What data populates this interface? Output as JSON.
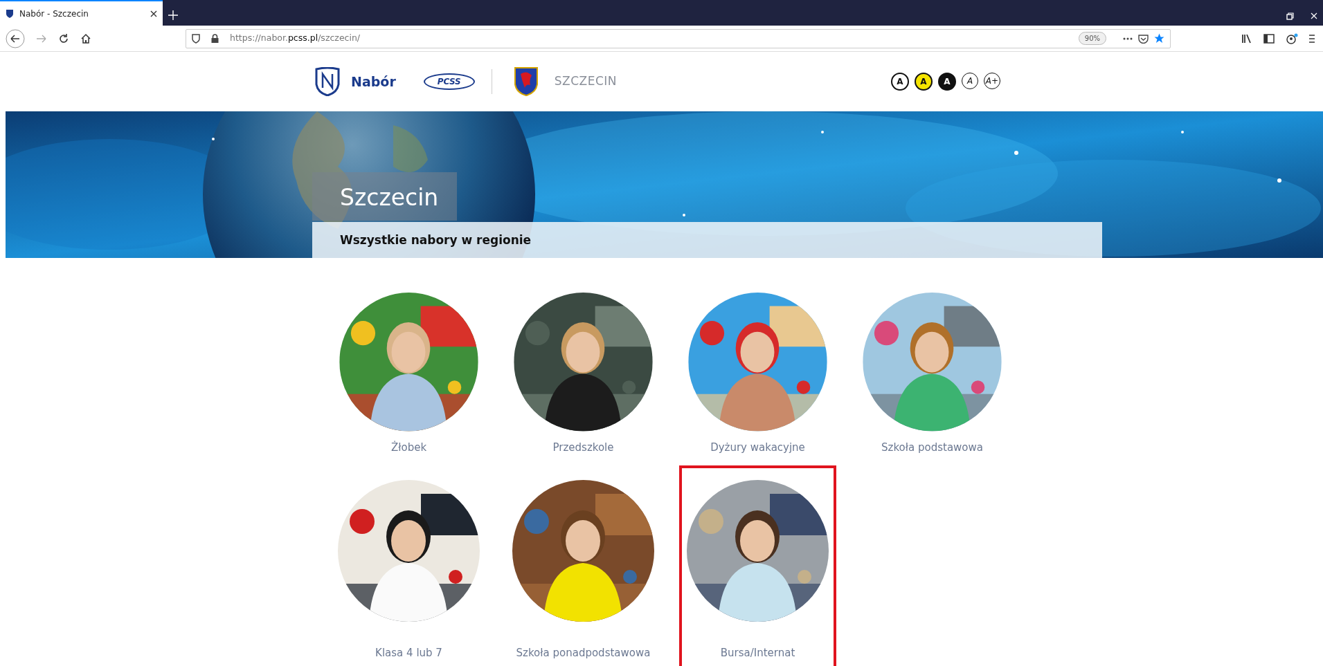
{
  "browser": {
    "tab_title": "Nabór - Szczecin",
    "url_prefix": "https://nabor.",
    "url_domain": "pcss.pl",
    "url_path": "/szczecin/",
    "zoom": "90%"
  },
  "header": {
    "brand": "Nabór",
    "partner": "PCSS",
    "city": "SZCZECIN",
    "contrast_buttons": [
      {
        "label": "A",
        "kind": "outline"
      },
      {
        "label": "A",
        "kind": "yellow"
      },
      {
        "label": "A",
        "kind": "dark"
      },
      {
        "label": "A",
        "kind": "thin"
      },
      {
        "label": "A+",
        "kind": "thin"
      }
    ]
  },
  "banner": {
    "title": "Szczecin",
    "subtitle": "Wszystkie nabory w regionie"
  },
  "categories": [
    {
      "label": "Żłobek",
      "highlighted": false
    },
    {
      "label": "Przedszkole",
      "highlighted": false
    },
    {
      "label": "Dyżury wakacyjne",
      "highlighted": false
    },
    {
      "label": "Szkoła podstawowa",
      "highlighted": false
    },
    {
      "label": "Klasa 4 lub 7",
      "highlighted": false
    },
    {
      "label": "Szkoła ponadpodstawowa",
      "highlighted": false
    },
    {
      "label": "Bursa/Internat",
      "highlighted": true
    }
  ]
}
